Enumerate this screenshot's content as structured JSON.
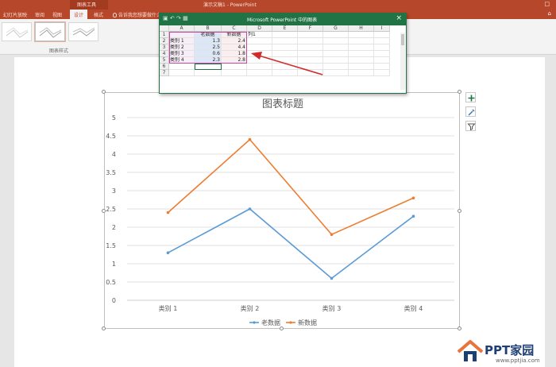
{
  "titlebar": {
    "context_tab": "图表工具",
    "document_title": "演示文稿1 - PowerPoint",
    "window_icon": "□"
  },
  "tabs": [
    "幻灯片放映",
    "审阅",
    "视图",
    "设计",
    "格式"
  ],
  "tellme": "告诉我您想要做什么...",
  "share_icon": "⌂",
  "ribbon": {
    "group_label": "图表样式"
  },
  "excel": {
    "title": "Microsoft PowerPoint 中的图表",
    "close": "×",
    "columns": [
      "A",
      "B",
      "C",
      "D",
      "E",
      "F",
      "G",
      "H",
      "I"
    ],
    "rows": [
      {
        "num": "1",
        "a": "",
        "b": "老数据",
        "c": "新数据",
        "d": "列1"
      },
      {
        "num": "2",
        "a": "类别 1",
        "b": "1.3",
        "c": "2.4",
        "d": ""
      },
      {
        "num": "3",
        "a": "类别 2",
        "b": "2.5",
        "c": "4.4",
        "d": ""
      },
      {
        "num": "4",
        "a": "类别 3",
        "b": "0.6",
        "c": "1.8",
        "d": ""
      },
      {
        "num": "5",
        "a": "类别 4",
        "b": "2.3",
        "c": "2.8",
        "d": ""
      },
      {
        "num": "6",
        "a": "",
        "b": "",
        "c": "",
        "d": ""
      },
      {
        "num": "7",
        "a": "",
        "b": "",
        "c": "",
        "d": ""
      }
    ]
  },
  "chart_data": {
    "type": "line",
    "title": "图表标题",
    "categories": [
      "类别 1",
      "类别 2",
      "类别 3",
      "类别 4"
    ],
    "series": [
      {
        "name": "老数据",
        "values": [
          1.3,
          2.5,
          0.6,
          2.3
        ],
        "color": "#5b9bd5"
      },
      {
        "name": "新数据",
        "values": [
          2.4,
          4.4,
          1.8,
          2.8
        ],
        "color": "#ed7d31"
      }
    ],
    "yticks": [
      "0",
      "0.5",
      "1",
      "1.5",
      "2",
      "2.5",
      "3",
      "3.5",
      "4",
      "4.5",
      "5"
    ],
    "ylim": [
      0,
      5
    ],
    "grid": true,
    "legend": "bottom"
  },
  "watermark": {
    "text": "PPT家园",
    "url": "www.pptjia.com"
  }
}
